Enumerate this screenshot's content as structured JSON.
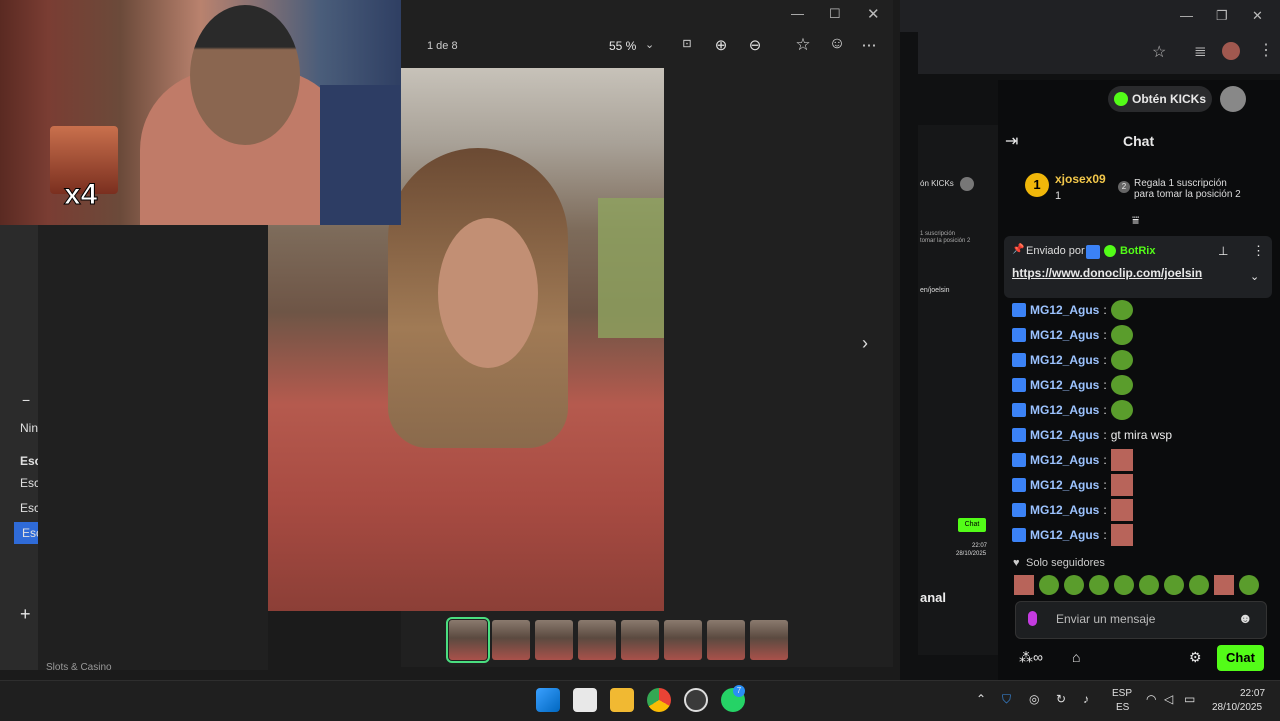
{
  "viewer": {
    "page_indicator": "1 de 8",
    "zoom": "55 %",
    "thumbnail_count": 8,
    "selected_thumbnail": 1
  },
  "webcam": {
    "multiplier": "x4"
  },
  "left_window": {
    "minus": "−",
    "items": [
      "Nin",
      "Esc",
      "Esc",
      "Esc",
      "Esc"
    ],
    "plus": "+",
    "bottom_text": "Slots & Casino"
  },
  "background_window": {
    "kicks_small": "ón KICKs",
    "sub_text_1": "1 suscripción",
    "sub_text_2": "tomar la posición 2",
    "link_small": "en/joelsin",
    "chat_small": "Chat",
    "time_small": "22:07",
    "date_small": "28/10/2025",
    "canal_small": "anal"
  },
  "kick": {
    "get_kicks": "Obtén KICKs",
    "chat_title": "Chat",
    "leader": {
      "name": "xjosex09",
      "count": "1",
      "rank": "2",
      "gift_text_1": "Regala 1 suscripción",
      "gift_text_2": "para tomar la posición 2"
    },
    "pinned": {
      "sent_by": "Enviado por",
      "bot": "BotRix",
      "link": "https://www.donoclip.com/joelsin"
    },
    "messages": [
      {
        "user": "MG12_Agus",
        "text": "",
        "emote": "frog"
      },
      {
        "user": "MG12_Agus",
        "text": "",
        "emote": "frog"
      },
      {
        "user": "MG12_Agus",
        "text": "",
        "emote": "frog"
      },
      {
        "user": "MG12_Agus",
        "text": "",
        "emote": "frog"
      },
      {
        "user": "MG12_Agus",
        "text": "",
        "emote": "frog"
      },
      {
        "user": "MG12_Agus",
        "text": "gt mira wsp",
        "emote": ""
      },
      {
        "user": "MG12_Agus",
        "text": "",
        "emote": "face"
      },
      {
        "user": "MG12_Agus",
        "text": "",
        "emote": "face"
      },
      {
        "user": "MG12_Agus",
        "text": "",
        "emote": "face"
      },
      {
        "user": "MG12_Agus",
        "text": "",
        "emote": "face"
      }
    ],
    "followers_only": "Solo seguidores",
    "input_placeholder": "Enviar un mensaje",
    "chat_button": "Chat"
  },
  "taskbar": {
    "lang_1": "ESP",
    "lang_2": "ES",
    "time": "22:07",
    "date": "28/10/2025",
    "whatsapp_badge": "7"
  },
  "colors": {
    "kick_green": "#53fc18",
    "selected_thumb": "#4ade80",
    "username": "#9cc3ff",
    "verified_badge": "#3b82f6"
  }
}
